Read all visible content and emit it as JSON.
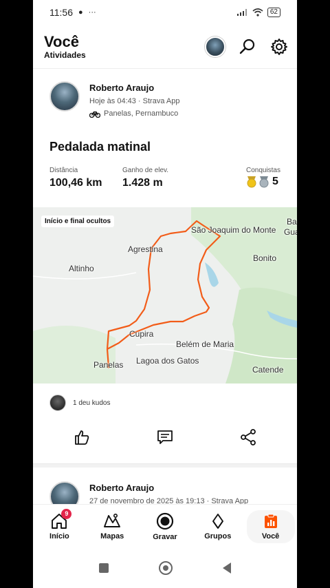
{
  "status_bar": {
    "time": "11:56",
    "battery": "62"
  },
  "header": {
    "title": "Você",
    "subtitle": "Atividades"
  },
  "activity": {
    "athlete_name": "Roberto Araujo",
    "meta": "Hoje às 04:43 · Strava App",
    "location": "Panelas, Pernambuco",
    "title": "Pedalada matinal",
    "stats": [
      {
        "label": "Distância",
        "value": "100,46 km"
      },
      {
        "label": "Ganho de elev.",
        "value": "1.428 m"
      }
    ],
    "achievements": {
      "label": "Conquistas",
      "count": "5"
    },
    "map": {
      "badge": "Início e final ocultos",
      "towns": [
        "São Joaquim do Monte",
        "Agrestina",
        "Altinho",
        "Bonito",
        "Cupira",
        "Belém de Maria",
        "Lagoa dos Gatos",
        "Panelas",
        "Catende",
        "Ba",
        "Gua"
      ]
    },
    "kudos": "1 deu kudos"
  },
  "next_activity": {
    "athlete_name": "Roberto Araujo",
    "meta": "27 de novembro de 2025 às 19:13 · Strava App"
  },
  "nav": {
    "items": [
      "Início",
      "Mapas",
      "Gravar",
      "Grupos",
      "Você"
    ],
    "badge": "9",
    "accent": "#fc5200"
  }
}
